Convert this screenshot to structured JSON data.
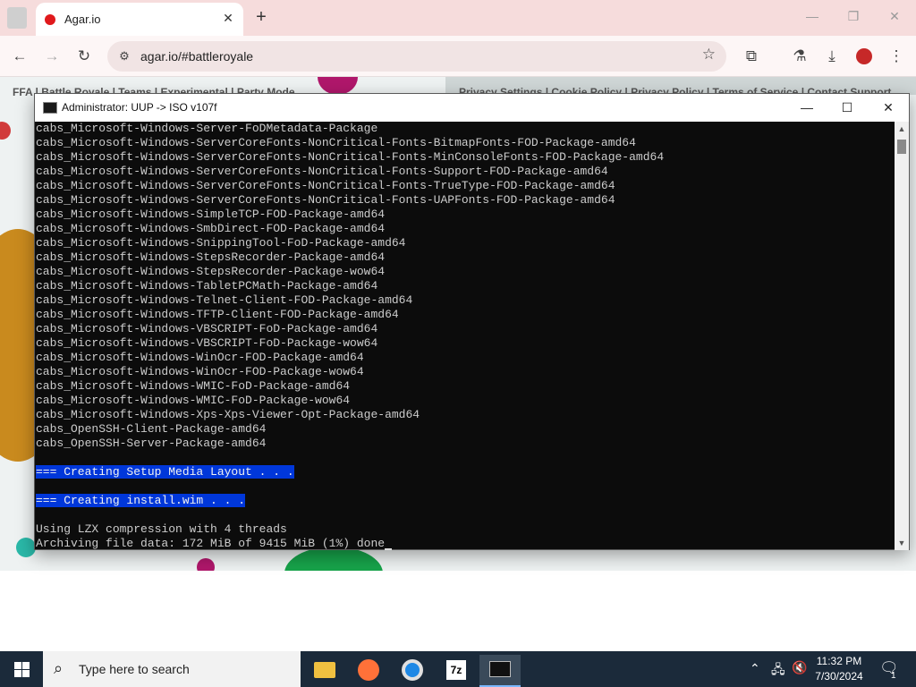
{
  "browser": {
    "tab_title": "Agar.io",
    "tab_close": "✕",
    "new_tab": "+",
    "url": "agar.io/#battleroyale",
    "window_minimize": "—",
    "window_restore": "❐",
    "window_close": "✕"
  },
  "site": {
    "nav_left": "FFA | Battle Royale | Teams | Experimental | Party Mode",
    "nav_right": "Privacy Settings | Cookie Policy | Privacy Policy | Terms of Service | Contact Support"
  },
  "console": {
    "title": "Administrator:  UUP -> ISO v107f",
    "minimize": "—",
    "maximize": "☐",
    "close": "✕",
    "lines": [
      "cabs_Microsoft-Windows-Server-FoDMetadata-Package",
      "cabs_Microsoft-Windows-ServerCoreFonts-NonCritical-Fonts-BitmapFonts-FOD-Package-amd64",
      "cabs_Microsoft-Windows-ServerCoreFonts-NonCritical-Fonts-MinConsoleFonts-FOD-Package-amd64",
      "cabs_Microsoft-Windows-ServerCoreFonts-NonCritical-Fonts-Support-FOD-Package-amd64",
      "cabs_Microsoft-Windows-ServerCoreFonts-NonCritical-Fonts-TrueType-FOD-Package-amd64",
      "cabs_Microsoft-Windows-ServerCoreFonts-NonCritical-Fonts-UAPFonts-FOD-Package-amd64",
      "cabs_Microsoft-Windows-SimpleTCP-FOD-Package-amd64",
      "cabs_Microsoft-Windows-SmbDirect-FOD-Package-amd64",
      "cabs_Microsoft-Windows-SnippingTool-FoD-Package-amd64",
      "cabs_Microsoft-Windows-StepsRecorder-Package-amd64",
      "cabs_Microsoft-Windows-StepsRecorder-Package-wow64",
      "cabs_Microsoft-Windows-TabletPCMath-Package-amd64",
      "cabs_Microsoft-Windows-Telnet-Client-FOD-Package-amd64",
      "cabs_Microsoft-Windows-TFTP-Client-FOD-Package-amd64",
      "cabs_Microsoft-Windows-VBSCRIPT-FoD-Package-amd64",
      "cabs_Microsoft-Windows-VBSCRIPT-FoD-Package-wow64",
      "cabs_Microsoft-Windows-WinOcr-FOD-Package-amd64",
      "cabs_Microsoft-Windows-WinOcr-FOD-Package-wow64",
      "cabs_Microsoft-Windows-WMIC-FoD-Package-amd64",
      "cabs_Microsoft-Windows-WMIC-FoD-Package-wow64",
      "cabs_Microsoft-Windows-Xps-Xps-Viewer-Opt-Package-amd64",
      "cabs_OpenSSH-Client-Package-amd64",
      "cabs_OpenSSH-Server-Package-amd64"
    ],
    "section1": "=== Creating Setup Media Layout . . .",
    "section2": "=== Creating install.wim . . .",
    "compression": "Using LZX compression with 4 threads",
    "progress": "Archiving file data: 172 MiB of 9415 MiB (1%) done"
  },
  "taskbar": {
    "search_placeholder": "Type here to search",
    "time": "11:32 PM",
    "date": "7/30/2024",
    "notification_count": "1",
    "apps": [
      "file-explorer-icon",
      "firefox-icon",
      "chrome-icon",
      "7zip-icon",
      "terminal-icon"
    ]
  },
  "colors": {
    "console_highlight": "#0037da",
    "tabstrip_bg": "#f6dcdc",
    "taskbar_bg": "#1b2a3a"
  }
}
